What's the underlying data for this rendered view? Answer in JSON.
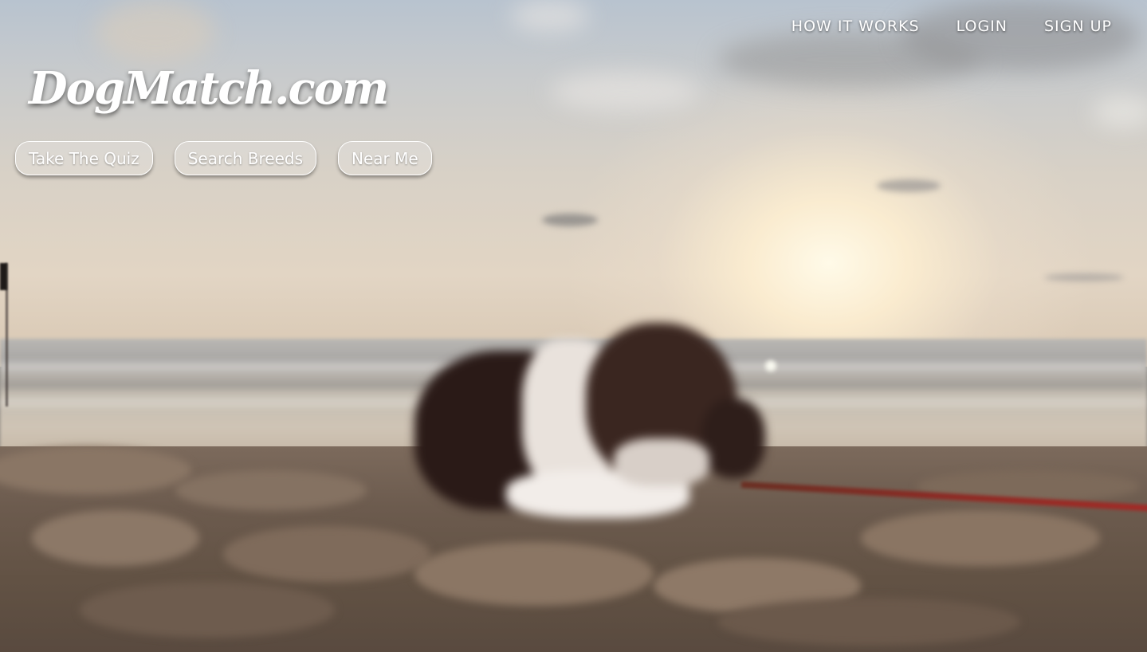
{
  "nav": {
    "items": [
      {
        "label": "HOW IT WORKS"
      },
      {
        "label": "LOGIN"
      },
      {
        "label": "SIGN UP"
      }
    ]
  },
  "brand": {
    "logo_text": "DogMatch.com"
  },
  "actions": {
    "quiz_label": "Take The Quiz",
    "breeds_label": "Search Breeds",
    "near_label": "Near Me"
  },
  "hero": {
    "image_subject": "puppy on beach at sunset",
    "leash_color": "#a32a26"
  }
}
